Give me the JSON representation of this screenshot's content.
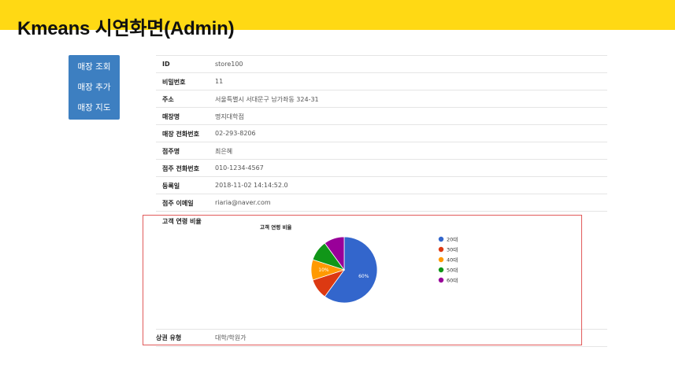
{
  "slide": {
    "title": "Kmeans 시연화면(Admin)"
  },
  "sidebar": {
    "items": [
      {
        "label": "매장 조회"
      },
      {
        "label": "매장 추가"
      },
      {
        "label": "매장 지도"
      }
    ]
  },
  "details": {
    "rows": [
      {
        "key": "ID",
        "value": "store100"
      },
      {
        "key": "비밀번호",
        "value": "11"
      },
      {
        "key": "주소",
        "value": "서울특별시 서대문구 남가좌동 324-31"
      },
      {
        "key": "매장명",
        "value": "명지대학점"
      },
      {
        "key": "매장 전화번호",
        "value": "02-293-8206"
      },
      {
        "key": "점주명",
        "value": "최은혜"
      },
      {
        "key": "점주 전화번호",
        "value": "010-1234-4567"
      },
      {
        "key": "등록일",
        "value": "2018-11-02 14:14:52.0"
      },
      {
        "key": "점주 이메일",
        "value": "riaria@naver.com"
      }
    ],
    "age_ratio_label": "고객 연령 비율",
    "commercial_key": "상권 유형",
    "commercial_value": "대학/학원가"
  },
  "chart_data": {
    "type": "pie",
    "title": "고객 연령 비율",
    "legend_position": "right",
    "categories": [
      "20대",
      "30대",
      "40대",
      "50대",
      "60대"
    ],
    "values": [
      60,
      10,
      10,
      10,
      10
    ],
    "slice_labels": [
      "60%",
      "",
      "10%",
      "",
      ""
    ],
    "colors": [
      "#3366cc",
      "#dc3912",
      "#ff9900",
      "#109618",
      "#990099"
    ]
  }
}
